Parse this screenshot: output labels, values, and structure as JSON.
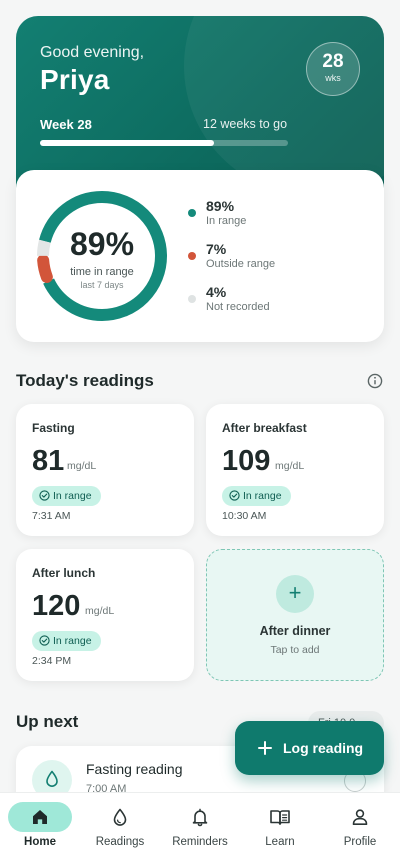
{
  "hero": {
    "greeting": "Good evening,",
    "name": "Priya",
    "weeks_badge": {
      "value": "28",
      "unit": "wks"
    },
    "week_label": "Week 28",
    "weeks_to_go": "12 weeks to go",
    "progress_fraction": 0.7
  },
  "stats": {
    "ring": {
      "percent_label": "89%",
      "label": "time in range",
      "sublabel": "last 7 days"
    },
    "segments": [
      {
        "value": 0.89,
        "color": "#148a7b"
      },
      {
        "value": 0.07,
        "color": "#d2553a"
      },
      {
        "value": 0.04,
        "color": "#e3e6e6"
      }
    ],
    "legend": [
      {
        "value": "89%",
        "label": "In range",
        "color": "#148a7b"
      },
      {
        "value": "7%",
        "label": "Outside range",
        "color": "#d2553a"
      },
      {
        "value": "4%",
        "label": "Not recorded",
        "color": "#dfe3e3"
      }
    ]
  },
  "today": {
    "title": "Today's readings",
    "info_icon": "info-icon",
    "readings": [
      {
        "title": "Fasting",
        "value": "81",
        "unit": "mg/dL",
        "status": "In range",
        "time": "7:31 AM"
      },
      {
        "title": "After breakfast",
        "value": "109",
        "unit": "mg/dL",
        "status": "In range",
        "time": "10:30 AM"
      },
      {
        "title": "After lunch",
        "value": "120",
        "unit": "mg/dL",
        "status": "In range",
        "time": "2:34 PM"
      }
    ],
    "add": {
      "icon": "plus-icon",
      "title": "After dinner",
      "subtitle": "Tap to add"
    }
  },
  "up_next": {
    "title": "Up next",
    "date": "Fri 10 0",
    "item": {
      "icon": "drop-icon",
      "title": "Fasting reading",
      "time": "7:00 AM"
    }
  },
  "fab": {
    "icon": "plus-icon",
    "label": "Log reading"
  },
  "nav": {
    "items": [
      {
        "label": "Home",
        "icon": "home-icon",
        "active": true
      },
      {
        "label": "Readings",
        "icon": "drop-icon",
        "active": false
      },
      {
        "label": "Reminders",
        "icon": "bell-icon",
        "active": false
      },
      {
        "label": "Learn",
        "icon": "book-icon",
        "active": false
      },
      {
        "label": "Profile",
        "icon": "person-icon",
        "active": false
      }
    ]
  },
  "colors": {
    "primary": "#0f7a6d",
    "accent_light": "#c7f2e6",
    "alert": "#d2553a"
  }
}
